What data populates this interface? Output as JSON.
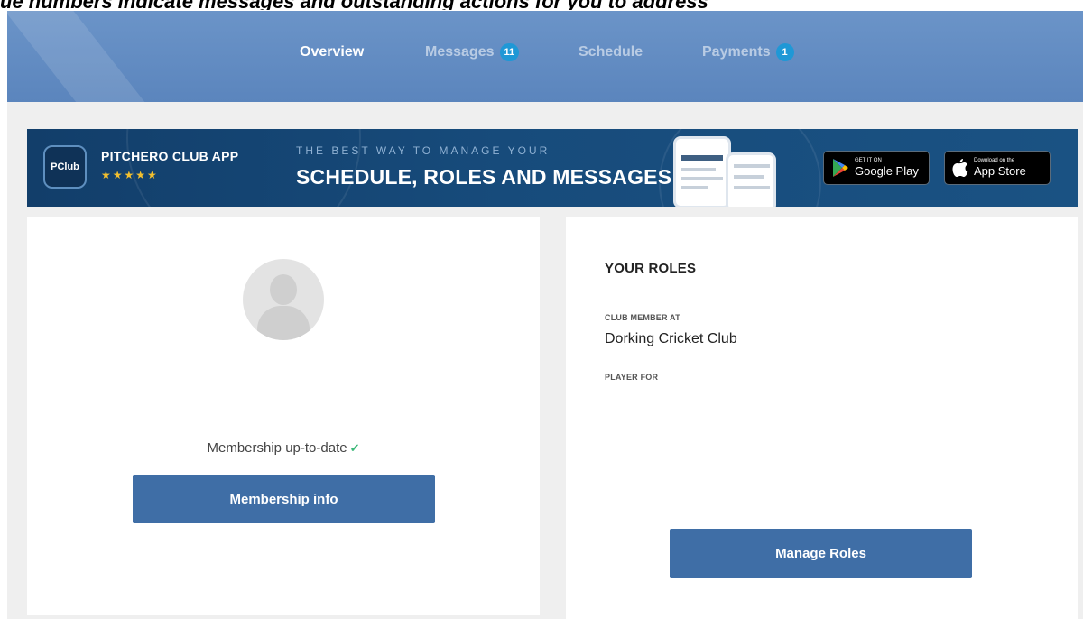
{
  "caption": "ue numbers indicate messages and outstanding actions for you to address",
  "nav": {
    "items": [
      {
        "label": "Overview",
        "active": true
      },
      {
        "label": "Messages",
        "badge": "11"
      },
      {
        "label": "Schedule"
      },
      {
        "label": "Payments",
        "badge": "1"
      }
    ]
  },
  "banner": {
    "logo_text": "PClub",
    "app_name": "PITCHERO CLUB APP",
    "stars": "★★★★★",
    "tagline_small": "THE BEST WAY TO MANAGE YOUR",
    "tagline_big": "SCHEDULE, ROLES AND MESSAGES",
    "google_play": {
      "small": "GET IT ON",
      "big": "Google Play"
    },
    "app_store": {
      "small": "Download on the",
      "big": "App Store"
    }
  },
  "membership": {
    "status": "Membership up-to-date",
    "button_label": "Membership info"
  },
  "roles": {
    "title": "YOUR ROLES",
    "club_member_label": "CLUB MEMBER AT",
    "club_member_value": "Dorking Cricket Club",
    "player_for_label": "PLAYER FOR",
    "button_label": "Manage Roles"
  },
  "colors": {
    "nav_bg": "#5f88c0",
    "badge": "#1f98d6",
    "banner_bg": "#154677",
    "button": "#3f6ea6",
    "check": "#3cb878"
  }
}
